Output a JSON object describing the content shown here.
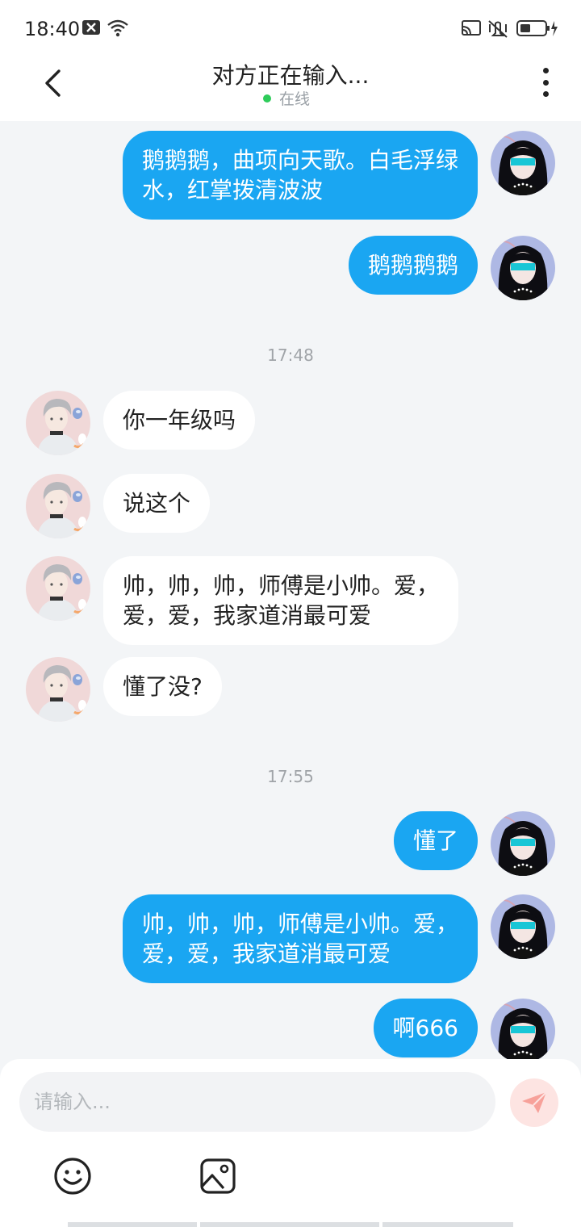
{
  "status_bar": {
    "time": "18:40"
  },
  "header": {
    "title": "对方正在输入...",
    "online_label": "在线"
  },
  "messages": [
    {
      "side": "me",
      "text_lines": [
        "鹅鹅鹅，曲项向天歌。白毛浮绿",
        "水，红掌拨清波波"
      ]
    },
    {
      "side": "me",
      "text_lines": [
        "鹅鹅鹅鹅"
      ]
    },
    {
      "timestamp": "17:48"
    },
    {
      "side": "them",
      "text_lines": [
        "你一年级吗"
      ]
    },
    {
      "side": "them",
      "text_lines": [
        "说这个"
      ]
    },
    {
      "side": "them",
      "text_lines": [
        "帅，帅，帅，师傅是小帅。爱，",
        "爱，爱，我家道消最可爱"
      ]
    },
    {
      "side": "them",
      "text_lines": [
        "懂了没?"
      ]
    },
    {
      "timestamp": "17:55"
    },
    {
      "side": "me",
      "text_lines": [
        "懂了"
      ]
    },
    {
      "side": "me",
      "text_lines": [
        "帅，帅，帅，师傅是小帅。爱，",
        "爱，爱，我家道消最可爱"
      ]
    },
    {
      "side": "me",
      "text_lines": [
        "啊666"
      ]
    }
  ],
  "composer": {
    "placeholder": "请输入...",
    "icons": [
      "emoji-icon",
      "image-icon",
      "send-icon"
    ]
  },
  "colors": {
    "my_bubble": "#1aa6f2",
    "their_bubble": "#ffffff",
    "background": "#f3f5f7",
    "online_dot": "#2ecc5a",
    "send_button": "#fde4e2",
    "send_icon": "#f7a19a"
  }
}
